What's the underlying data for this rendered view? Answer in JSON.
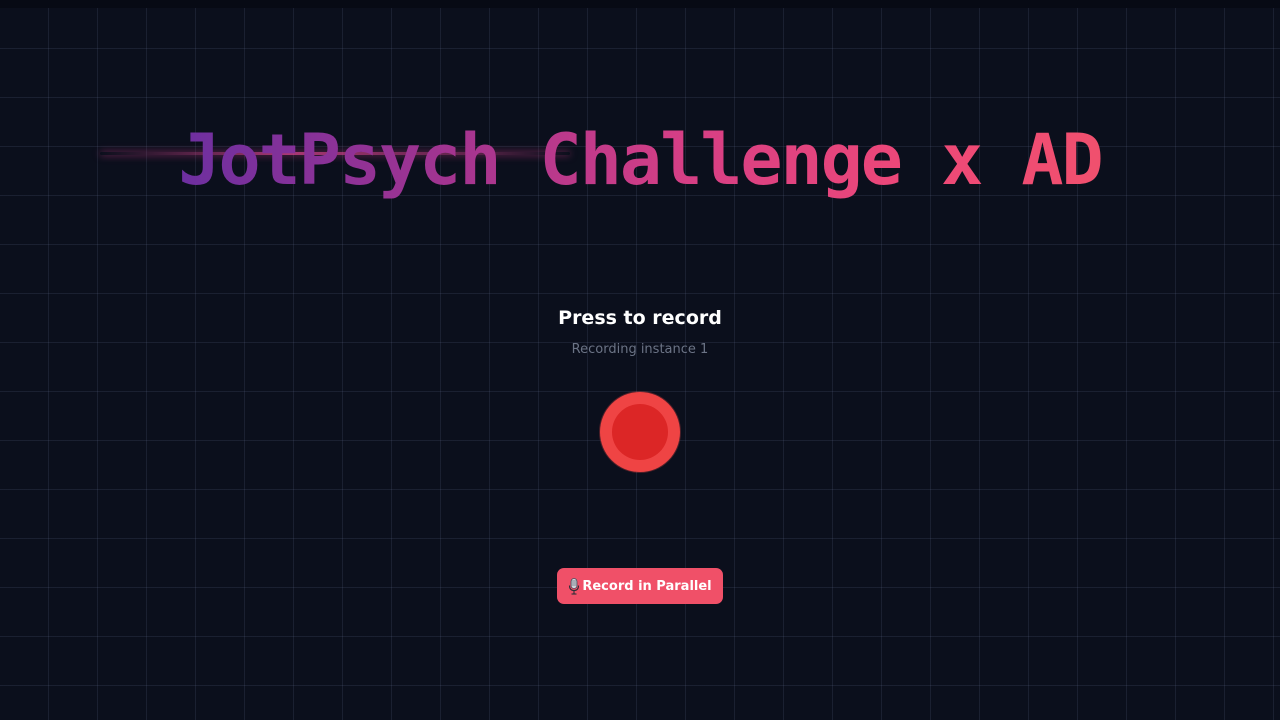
{
  "header": {
    "title": "JotPsych Challenge x AD"
  },
  "recorder": {
    "prompt": "Press to record",
    "instance_label": "Recording instance 1",
    "record_button_color": "#ef4444"
  },
  "actions": {
    "parallel_label": "Record in Parallel",
    "parallel_icon": "microphone-icon"
  },
  "colors": {
    "background": "#0b0f1c",
    "title_gradient_start": "#6d2fa0",
    "title_gradient_end": "#f0506e",
    "accent": "#f05068"
  }
}
